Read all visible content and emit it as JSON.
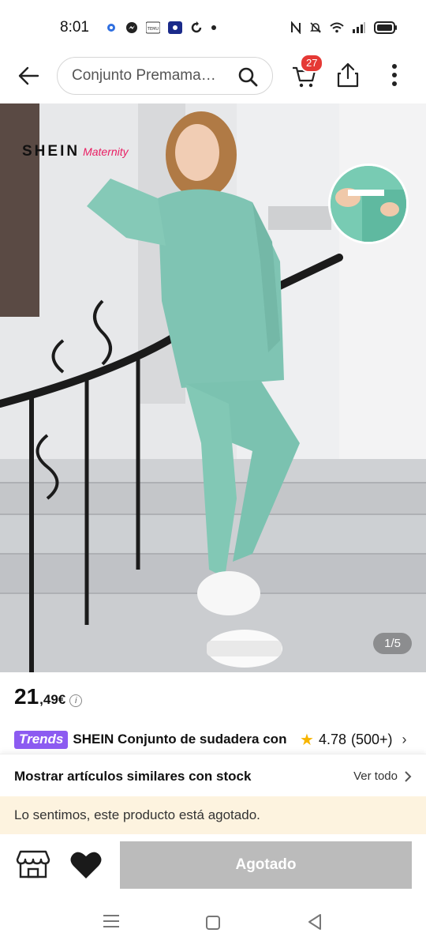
{
  "status_bar": {
    "time": "8:01",
    "temu_label": "TEMU"
  },
  "header": {
    "search_text": "Conjunto Premama…",
    "cart_count": "27"
  },
  "gallery": {
    "brand": "SHEIN",
    "brand_sub": "Maternity",
    "counter": "1/5"
  },
  "product": {
    "price_int": "21",
    "price_dec": ",49€",
    "info_icon": "i",
    "trends_label": "Trends",
    "title": "SHEIN Conjunto de sudadera con",
    "rating": "4.78",
    "reviews": "(500+)"
  },
  "similar": {
    "title": "Mostrar artículos similares con stock",
    "link": "Ver todo"
  },
  "notice": {
    "text": "Lo sentimos, este producto está agotado."
  },
  "actions": {
    "main_button": "Agotado"
  },
  "colors": {
    "badge": "#e53935",
    "trends": "#8c5bf1",
    "notice_bg": "#fdf3df",
    "disabled_button": "#bbbbbb",
    "star": "#f7b500"
  }
}
